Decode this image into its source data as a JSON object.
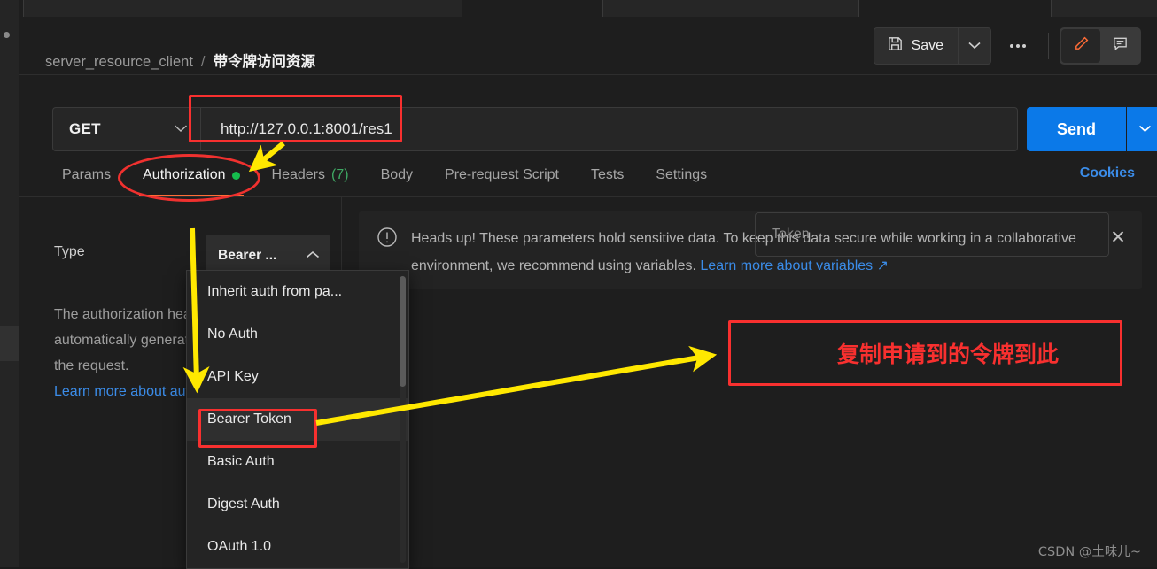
{
  "window": {
    "left_rail": "collections-rail"
  },
  "header": {
    "collection": "server_resource_client",
    "separator": "/",
    "request_name": "带令牌访问资源",
    "save_label": "Save",
    "save_icon": "floppy-disk-icon",
    "save_caret_icon": "chevron-down-icon",
    "more_icon": "ellipsis-icon",
    "edit_icon": "pencil-icon",
    "comment_icon": "comment-icon"
  },
  "url_bar": {
    "method": "GET",
    "method_caret_icon": "chevron-down-icon",
    "url": "http://127.0.0.1:8001/res1",
    "send_label": "Send",
    "send_caret_icon": "chevron-down-icon"
  },
  "tabs": {
    "items": [
      {
        "label": "Params",
        "active": false,
        "dot": false,
        "count": ""
      },
      {
        "label": "Authorization",
        "active": true,
        "dot": true,
        "count": ""
      },
      {
        "label": "Headers",
        "active": false,
        "dot": false,
        "count": "(7)"
      },
      {
        "label": "Body",
        "active": false,
        "dot": false,
        "count": ""
      },
      {
        "label": "Pre-request Script",
        "active": false,
        "dot": false,
        "count": ""
      },
      {
        "label": "Tests",
        "active": false,
        "dot": false,
        "count": ""
      },
      {
        "label": "Settings",
        "active": false,
        "dot": false,
        "count": ""
      }
    ],
    "cookies_label": "Cookies"
  },
  "auth": {
    "type_label": "Type",
    "selected_type": "Bearer ...",
    "select_caret_icon": "chevron-up-icon",
    "description": "The authorization header will be automatically generated when you send the request.",
    "description_link": "Learn more about authorization",
    "dropdown_options": [
      "Inherit auth from pa...",
      "No Auth",
      "API Key",
      "Bearer Token",
      "Basic Auth",
      "Digest Auth",
      "OAuth 1.0"
    ],
    "dropdown_selected": "Bearer Token"
  },
  "banner": {
    "icon": "alert-circle-icon",
    "text": "Heads up! These parameters hold sensitive data. To keep this data secure while working in a collaborative environment, we recommend using variables.",
    "link": "Learn more about variables",
    "link_icon": "external-link-icon",
    "close_icon": "close-icon"
  },
  "token": {
    "placeholder": "Token",
    "value": ""
  },
  "annotations": {
    "note_chinese": "复制申请到的令牌到此",
    "color_red": "#f8302f",
    "color_yellow": "#ffe800",
    "highlight_url": "url-box",
    "highlight_tab": "authorization-tab",
    "highlight_option": "bearer-token-option",
    "highlight_token": "token-field"
  },
  "watermark": {
    "text": "CSDN @土味儿~"
  }
}
